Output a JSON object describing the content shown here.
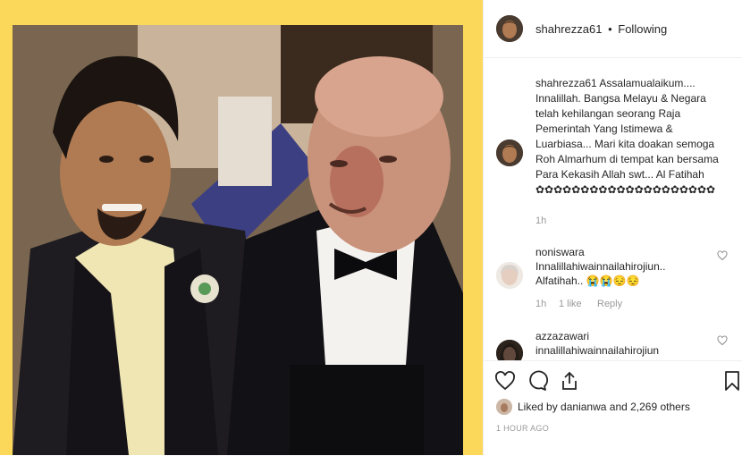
{
  "header": {
    "username": "shahrezza61",
    "separator": "•",
    "follow_status": "Following"
  },
  "caption": {
    "username": "shahrezza61",
    "text": "Assalamualaikum.... Innalillah. Bangsa Melayu & Negara telah kehilangan seorang Raja Pemerintah Yang Istimewa & Luarbiasa... Mari kita doakan semoga Roh Almarhum di tempat kan bersama Para Kekasih Allah swt... Al Fatihah ✿✿✿✿✿✿✿✿✿✿✿✿✿✿✿✿✿✿✿✿",
    "time": "1h"
  },
  "comments": [
    {
      "username": "noniswara",
      "text": "Innalillahiwainnailahirojiun.. Alfatihah.. 😭😭😔😔",
      "time": "1h",
      "likes": "1 like",
      "reply": "Reply"
    },
    {
      "username": "azzazawari",
      "text": "innalillahiwainnailahirojiun"
    }
  ],
  "likes": {
    "liked_by_prefix": "Liked by",
    "liked_by_user": "danianwa",
    "and_others": "and 2,269 others"
  },
  "timestamp": "1 HOUR AGO",
  "icons": [
    "heart-icon",
    "comment-icon",
    "share-icon",
    "bookmark-icon"
  ],
  "colors": {
    "background_pane": "#fbd75a",
    "muted_text": "#999999"
  }
}
